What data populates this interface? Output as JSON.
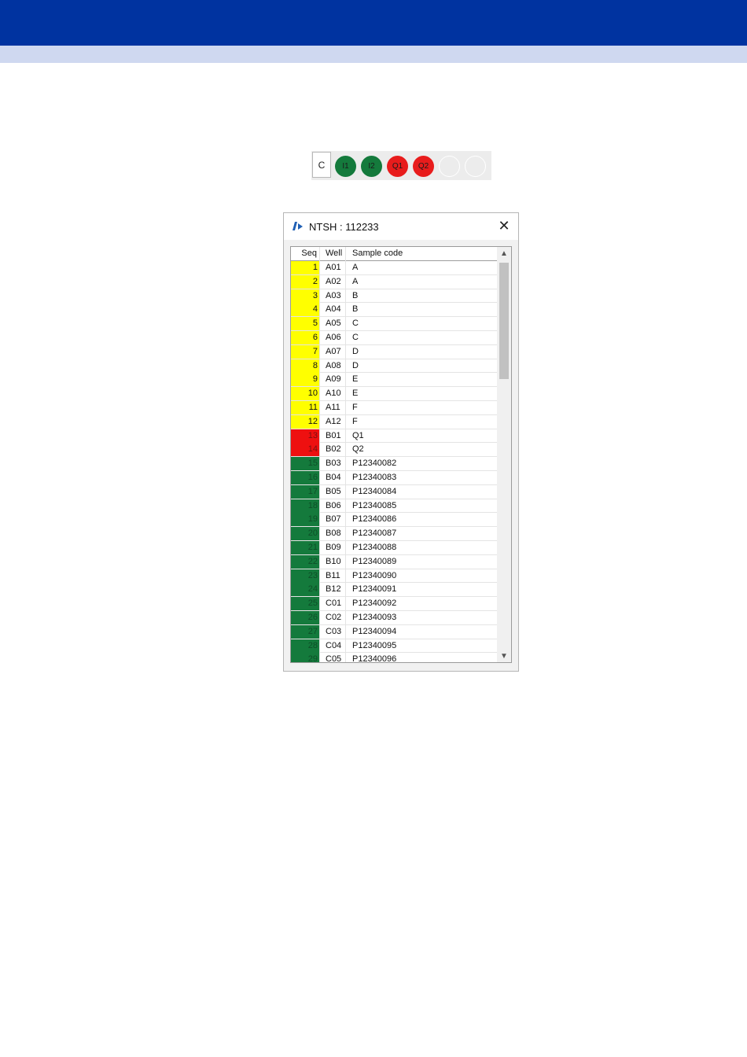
{
  "plate_strip": {
    "c_label": "C",
    "wells": [
      {
        "label": "I1",
        "color": "#147a3c"
      },
      {
        "label": "I2",
        "color": "#147a3c"
      },
      {
        "label": "Q1",
        "color": "#e81c1c"
      },
      {
        "label": "Q2",
        "color": "#e81c1c"
      },
      {
        "label": "",
        "color": "#ececec"
      },
      {
        "label": "",
        "color": "#ececec"
      }
    ]
  },
  "dialog": {
    "title": "NTSH : 112233",
    "close_glyph": "✕",
    "columns": [
      "Seq",
      "Well",
      "Sample code"
    ],
    "rows": [
      {
        "seq": "1",
        "well": "A01",
        "code": "A",
        "status": "yellow"
      },
      {
        "seq": "2",
        "well": "A02",
        "code": "A",
        "status": "yellow"
      },
      {
        "seq": "3",
        "well": "A03",
        "code": "B",
        "status": "yellow"
      },
      {
        "seq": "4",
        "well": "A04",
        "code": "B",
        "status": "yellow"
      },
      {
        "seq": "5",
        "well": "A05",
        "code": "C",
        "status": "yellow"
      },
      {
        "seq": "6",
        "well": "A06",
        "code": "C",
        "status": "yellow"
      },
      {
        "seq": "7",
        "well": "A07",
        "code": "D",
        "status": "yellow"
      },
      {
        "seq": "8",
        "well": "A08",
        "code": "D",
        "status": "yellow"
      },
      {
        "seq": "9",
        "well": "A09",
        "code": "E",
        "status": "yellow"
      },
      {
        "seq": "10",
        "well": "A10",
        "code": "E",
        "status": "yellow"
      },
      {
        "seq": "11",
        "well": "A11",
        "code": "F",
        "status": "yellow"
      },
      {
        "seq": "12",
        "well": "A12",
        "code": "F",
        "status": "yellow"
      },
      {
        "seq": "13",
        "well": "B01",
        "code": "Q1",
        "status": "red"
      },
      {
        "seq": "14",
        "well": "B02",
        "code": "Q2",
        "status": "red"
      },
      {
        "seq": "15",
        "well": "B03",
        "code": "P12340082",
        "status": "green"
      },
      {
        "seq": "16",
        "well": "B04",
        "code": "P12340083",
        "status": "green"
      },
      {
        "seq": "17",
        "well": "B05",
        "code": "P12340084",
        "status": "green"
      },
      {
        "seq": "18",
        "well": "B06",
        "code": "P12340085",
        "status": "green"
      },
      {
        "seq": "19",
        "well": "B07",
        "code": "P12340086",
        "status": "green"
      },
      {
        "seq": "20",
        "well": "B08",
        "code": "P12340087",
        "status": "green"
      },
      {
        "seq": "21",
        "well": "B09",
        "code": "P12340088",
        "status": "green"
      },
      {
        "seq": "22",
        "well": "B10",
        "code": "P12340089",
        "status": "green"
      },
      {
        "seq": "23",
        "well": "B11",
        "code": "P12340090",
        "status": "green"
      },
      {
        "seq": "24",
        "well": "B12",
        "code": "P12340091",
        "status": "green"
      },
      {
        "seq": "25",
        "well": "C01",
        "code": "P12340092",
        "status": "green"
      },
      {
        "seq": "26",
        "well": "C02",
        "code": "P12340093",
        "status": "green"
      },
      {
        "seq": "27",
        "well": "C03",
        "code": "P12340094",
        "status": "green"
      },
      {
        "seq": "28",
        "well": "C04",
        "code": "P12340095",
        "status": "green"
      },
      {
        "seq": "29",
        "well": "C05",
        "code": "P12340096",
        "status": "green"
      }
    ]
  },
  "colors": {
    "header": "#0033a0",
    "subheader": "#cfd8f0",
    "yellow": "#ffff00",
    "red": "#ee1010",
    "green": "#147a3c"
  },
  "icons": {
    "logo": "app-logo-icon",
    "scroll_up": "chevron-up-icon",
    "scroll_down": "chevron-down-icon"
  }
}
